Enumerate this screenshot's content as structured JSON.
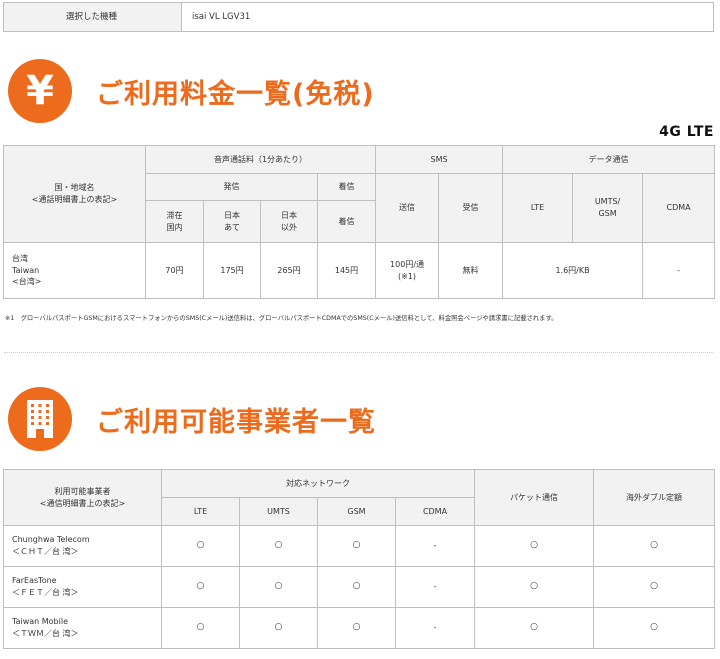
{
  "model": {
    "label": "選択した機種",
    "value": "isai VL LGV31"
  },
  "fees_section": {
    "icon_glyph": "¥",
    "title": "ご利用料金一覧(免税)"
  },
  "network_label": "4G LTE",
  "rate_table": {
    "col_country": "国・地域名\n<通話明細書上の表記>",
    "col_voice": "音声通話料（1分あたり）",
    "col_outgoing": "発信",
    "col_incoming": "着信",
    "col_stay": "滞在\n国内",
    "col_japan": "日本\nあて",
    "col_other": "日本\n以外",
    "col_incoming_sub": "着信",
    "col_sms": "SMS",
    "col_sms_send": "送信",
    "col_sms_recv": "受信",
    "col_data": "データ通信",
    "col_lte": "LTE",
    "col_umts": "UMTS/\nGSM",
    "col_cdma": "CDMA",
    "row": {
      "country": "台湾\nTaiwan\n<台湾>",
      "stay": "70円",
      "japan": "175円",
      "other": "265円",
      "incoming": "145円",
      "sms_send": "100円/通\n(※1)",
      "sms_recv": "無料",
      "data_lte_umts": "1.6円/KB",
      "cdma": "-"
    }
  },
  "footnote": "※1　グローバルパスポートGSMにおけるスマートフォンからのSMS(Cメール)送信料は、グローバルパスポートCDMAでのSMS(Cメール)送信料として、料金照会ページや請求書に記載されます。",
  "carriers_section": {
    "title": "ご利用可能事業者一覧"
  },
  "carrier_table": {
    "col_carrier": "利用可能事業者\n<通信明細書上の表記>",
    "col_network": "対応ネットワーク",
    "col_lte": "LTE",
    "col_umts": "UMTS",
    "col_gsm": "GSM",
    "col_cdma": "CDMA",
    "col_packet": "パケット通信",
    "col_flat": "海外ダブル定額",
    "rows": [
      {
        "name": "Chunghwa Telecom\n＜ＣＨＴ／台 湾＞",
        "lte": "○",
        "umts": "○",
        "gsm": "○",
        "cdma": "-",
        "packet": "○",
        "flat": "○"
      },
      {
        "name": "FarEasTone\n＜ＦＥＴ／台 湾＞",
        "lte": "○",
        "umts": "○",
        "gsm": "○",
        "cdma": "-",
        "packet": "○",
        "flat": "○"
      },
      {
        "name": "Taiwan Mobile\n＜ＴＷＭ／台 湾＞",
        "lte": "○",
        "umts": "○",
        "gsm": "○",
        "cdma": "-",
        "packet": "○",
        "flat": "○"
      }
    ]
  },
  "colors": {
    "accent": "#ec6b1c",
    "header_bg": "#f2f2f2",
    "border": "#bfbfbf"
  }
}
